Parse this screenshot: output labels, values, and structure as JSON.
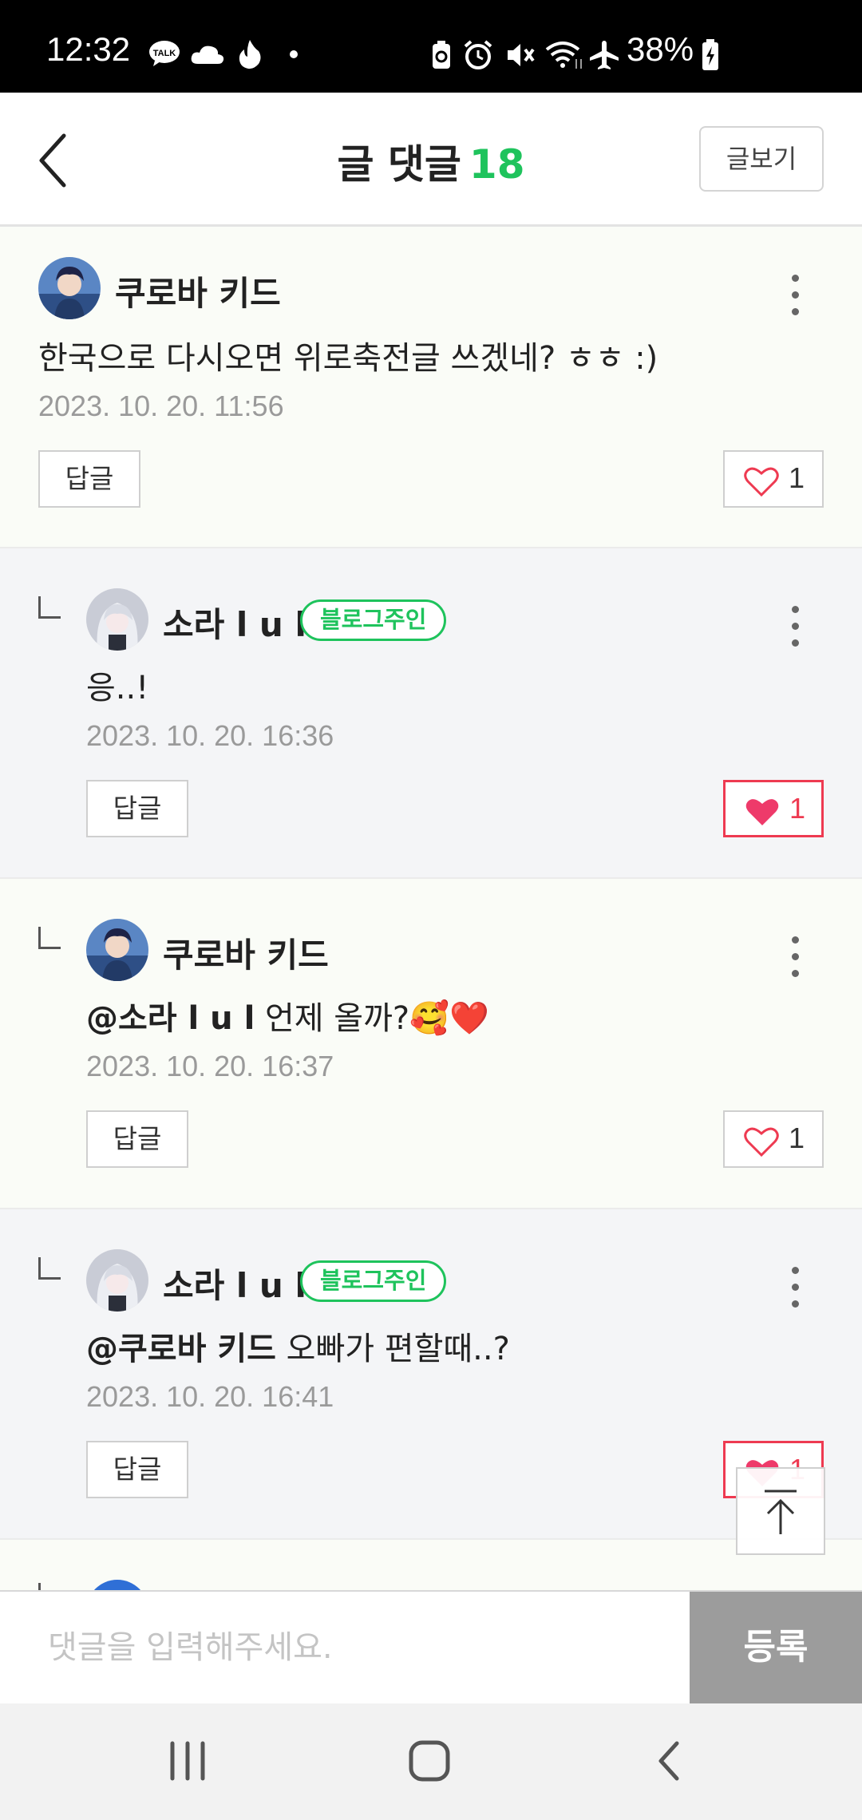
{
  "status_bar": {
    "time": "12:32",
    "battery": "38%",
    "icons": [
      "talk-icon",
      "cloud-icon",
      "fire-icon",
      "dot-icon",
      "recycle-icon",
      "alarm-icon",
      "mute-icon",
      "wifi-icon",
      "airplane-icon",
      "battery-charging-icon"
    ]
  },
  "header": {
    "title": "글 댓글",
    "count": "18",
    "view_post_label": "글보기"
  },
  "colors": {
    "accent_green": "#1ec35c",
    "like_red": "#ee3a51",
    "submit_gray": "#9c9c9c"
  },
  "comments": [
    {
      "author": "쿠로바 키드",
      "is_owner": false,
      "mention": "",
      "text": "한국으로 다시오면 위로축전글 쓰겠네? ㅎㅎ :)",
      "date": "2023. 10. 20. 11:56",
      "reply_label": "답글",
      "likes": "1",
      "liked": false,
      "is_reply": false
    },
    {
      "author": "소라 l u l",
      "is_owner": true,
      "owner_label": "블로그주인",
      "mention": "",
      "text": "응..!",
      "date": "2023. 10. 20. 16:36",
      "reply_label": "답글",
      "likes": "1",
      "liked": true,
      "is_reply": true
    },
    {
      "author": "쿠로바 키드",
      "is_owner": false,
      "mention": "@소라 l u l",
      "text": " 언제 올까?🥰❤️",
      "date": "2023. 10. 20. 16:37",
      "reply_label": "답글",
      "likes": "1",
      "liked": false,
      "is_reply": true
    },
    {
      "author": "소라 l u l",
      "is_owner": true,
      "owner_label": "블로그주인",
      "mention": "@쿠로바 키드",
      "text": " 오빠가 편할때..?",
      "date": "2023. 10. 20. 16:41",
      "reply_label": "답글",
      "likes": "1",
      "liked": true,
      "is_reply": true
    }
  ],
  "composer": {
    "placeholder": "댓글을 입력해주세요.",
    "submit_label": "등록"
  },
  "nav": [
    "recent-apps-icon",
    "home-icon",
    "back-icon"
  ]
}
